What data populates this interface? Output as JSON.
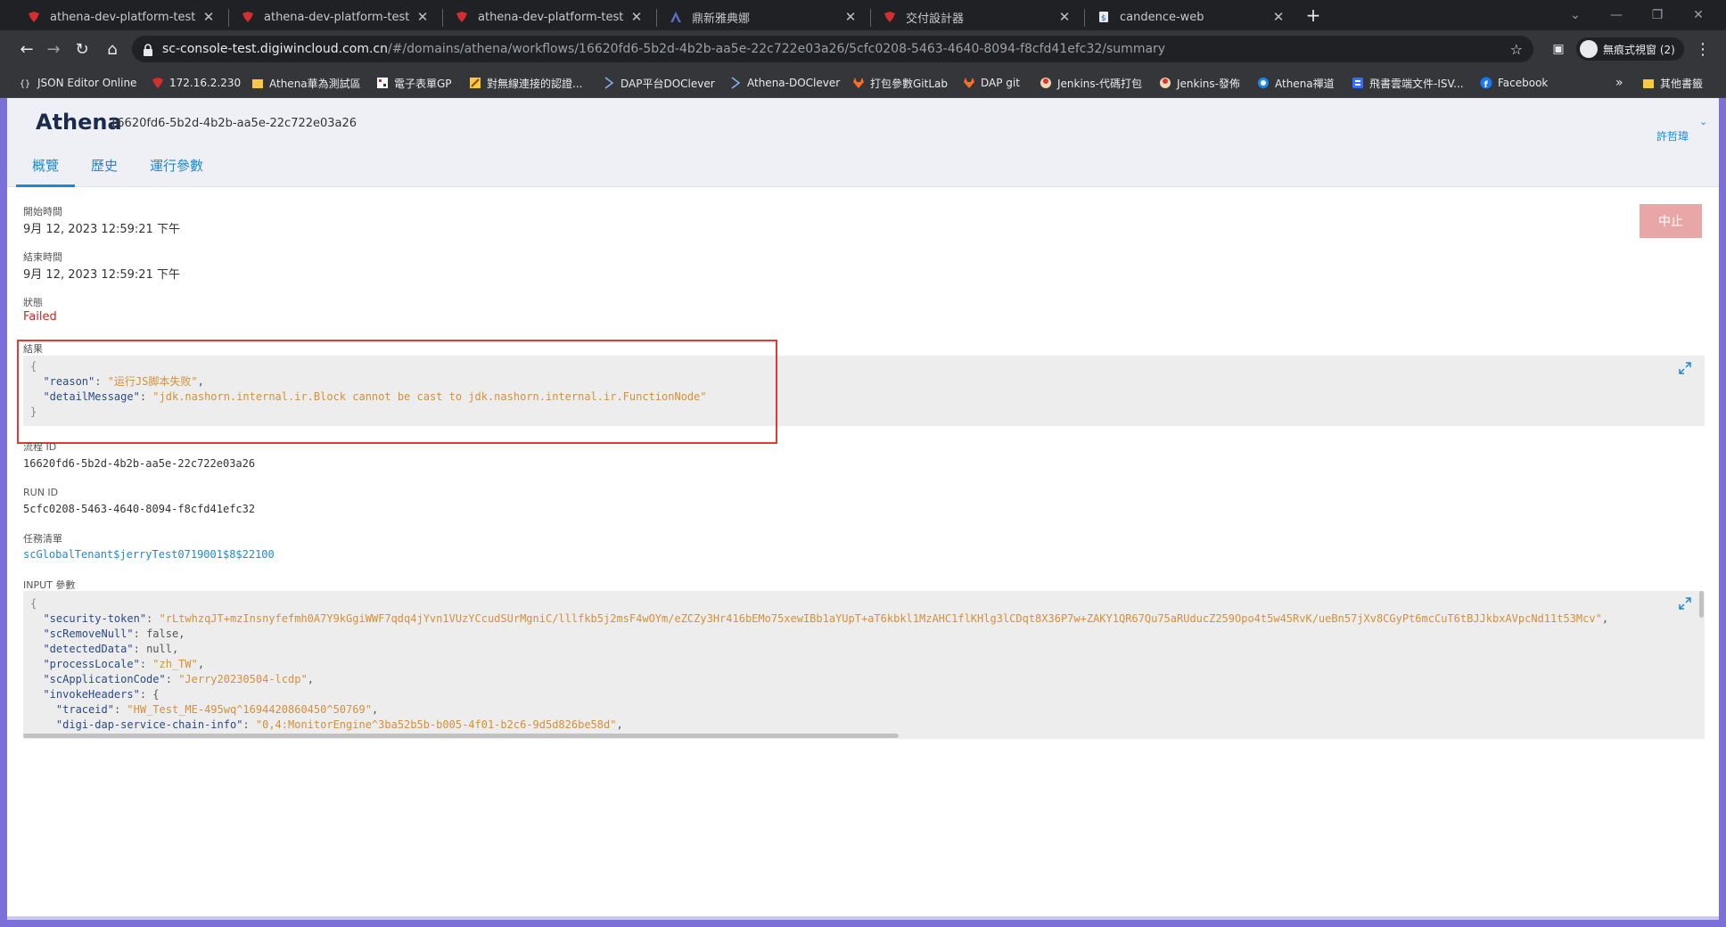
{
  "browser": {
    "tabs": [
      {
        "title": "athena-dev-platform-test.digiwincloud.com.cn",
        "favicon": "red-dragon-icon"
      },
      {
        "title": "athena-dev-platform-test.digiwincloud.com.cn",
        "favicon": "red-dragon-icon"
      },
      {
        "title": "athena-dev-platform-test.digiwincloud.com.cn",
        "favicon": "red-dragon-icon"
      },
      {
        "title": "鼎新雅典娜",
        "favicon": "athena-a-icon"
      },
      {
        "title": "交付設計器",
        "favicon": "red-dragon-icon"
      },
      {
        "title": "candence-web",
        "favicon": "document-icon"
      }
    ],
    "url_host": "sc-console-test.digiwincloud.com.cn",
    "url_path": "/#/domains/athena/workflows/16620fd6-5b2d-4b2b-aa5e-22c722e03a26/5cfc0208-5463-4640-8094-f8cfd41efc32/summary",
    "incognito_label": "無痕式視窗 (2)",
    "bookmarks": [
      {
        "label": "JSON Editor Online",
        "icon": "json-icon"
      },
      {
        "label": "172.16.2.230",
        "icon": "red-dragon-icon"
      },
      {
        "label": "Athena華為測試區",
        "icon": "folder-icon"
      },
      {
        "label": "電子表單GP",
        "icon": "grid-icon"
      },
      {
        "label": "對無線連接的認證...",
        "icon": "pencil-icon"
      },
      {
        "label": "DAP平台DOClever",
        "icon": "doclever-icon"
      },
      {
        "label": "Athena-DOClever",
        "icon": "doclever-icon"
      },
      {
        "label": "打包參數GitLab",
        "icon": "gitlab-icon"
      },
      {
        "label": "DAP git",
        "icon": "gitlab-icon"
      },
      {
        "label": "Jenkins-代碼打包",
        "icon": "jenkins-icon"
      },
      {
        "label": "Jenkins-發佈",
        "icon": "jenkins-icon"
      },
      {
        "label": "Athena禪道",
        "icon": "zentao-icon"
      },
      {
        "label": "飛書雲端文件-ISV...",
        "icon": "feishu-icon"
      },
      {
        "label": "Facebook",
        "icon": "facebook-icon"
      }
    ],
    "bookmarks_overflow": "»",
    "other_bookmarks": "其他書籤"
  },
  "header": {
    "brand": "Athena",
    "workflow_id": "16620fd6-5b2d-4b2b-aa5e-22c722e03a26",
    "user": "許哲瑋",
    "tabs": [
      {
        "label": "概覽"
      },
      {
        "label": "歷史"
      },
      {
        "label": "運行參數"
      }
    ]
  },
  "summary": {
    "start_label": "開始時間",
    "start_value": "9月 12, 2023 12:59:21 下午",
    "end_label": "結束時間",
    "end_value": "9月 12, 2023 12:59:21 下午",
    "status_label": "狀態",
    "status_value": "Failed",
    "result_label": "結果",
    "result": {
      "reason_key": "\"reason\"",
      "reason_value": "\"运行JS脚本失败\"",
      "detail_key": "\"detailMessage\"",
      "detail_value": "\"jdk.nashorn.internal.ir.Block cannot be cast to jdk.nashorn.internal.ir.FunctionNode\""
    },
    "flow_id_label": "流程 ID",
    "flow_id_value": "16620fd6-5b2d-4b2b-aa5e-22c722e03a26",
    "run_id_label": "RUN ID",
    "run_id_value": "5cfc0208-5463-4640-8094-f8cfd41efc32",
    "tasklist_label": "任務清單",
    "tasklist_value": "scGlobalTenant$jerryTest0719001$8$22100",
    "input_label": "INPUT 參數",
    "input": [
      {
        "key": "\"security-token\"",
        "value": "\"rLtwhzqJT+mzInsnyfefmh0A7Y9kGgiWWF7qdq4jYvn1VUzYCcudSUrMgniC/lllfkb5j2msF4wOYm/eZCZy3Hr416bEMo75xewIBb1aYUpT+aT6kbkl1MzAHC1flKHlg3lCDqt8X36P7w+ZAKY1QR67Qu75aRUducZ259Opo4t5w45RvK/ueBn57jXv8CGyPt6mcCuT6tBJJkbxAVpcNd11t53Mcv\"",
        "indent": 1,
        "comma": true
      },
      {
        "key": "\"scRemoveNull\"",
        "value": "false",
        "indent": 1,
        "comma": true,
        "plain": true
      },
      {
        "key": "\"detectedData\"",
        "value": "null",
        "indent": 1,
        "comma": true,
        "plain": true
      },
      {
        "key": "\"processLocale\"",
        "value": "\"zh_TW\"",
        "indent": 1,
        "comma": true
      },
      {
        "key": "\"scApplicationCode\"",
        "value": "\"Jerry20230504-lcdp\"",
        "indent": 1,
        "comma": true
      },
      {
        "key": "\"invokeHeaders\"",
        "value": "{",
        "indent": 1,
        "comma": false,
        "plain": true
      },
      {
        "key": "\"traceid\"",
        "value": "\"HW_Test_ME-495wq^1694420860450^50769\"",
        "indent": 2,
        "comma": true
      },
      {
        "key": "\"digi-dap-service-chain-info\"",
        "value": "\"0,4:MonitorEngine^3ba52b5b-b005-4f01-b2c6-9d5d826be58d\"",
        "indent": 2,
        "comma": true
      }
    ],
    "stop_label": "中止"
  }
}
